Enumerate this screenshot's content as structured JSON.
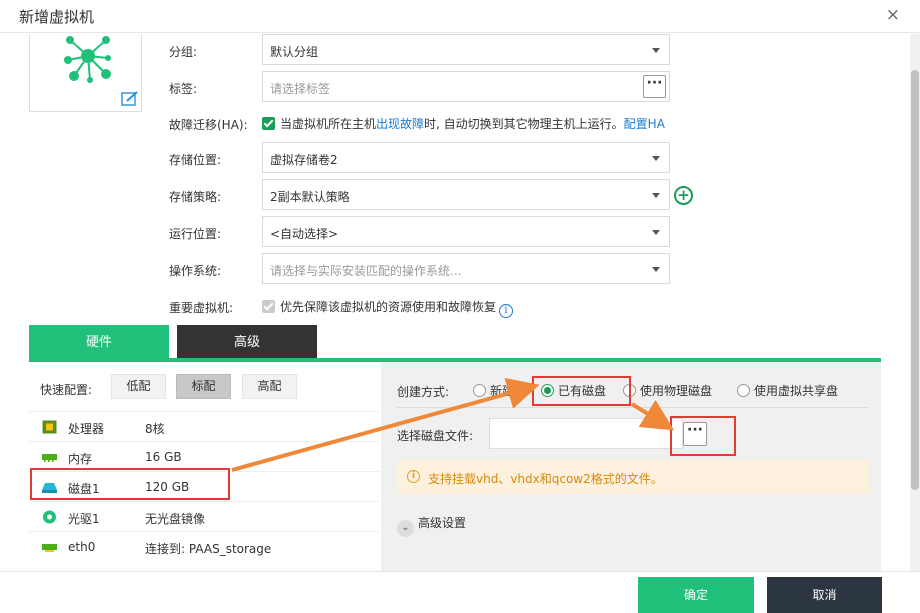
{
  "dialog": {
    "title": "新增虚拟机",
    "close_glyph": "×"
  },
  "form": {
    "group": {
      "label": "分组:",
      "value": "默认分组"
    },
    "tags": {
      "label": "标签:",
      "placeholder": "请选择标签",
      "button": "···"
    },
    "ha": {
      "label": "故障迁移(HA):",
      "text_before": "当虚拟机所在主机",
      "link_fault": "出现故障",
      "text_after": "时, 自动切换到其它物理主机上运行。",
      "link_config": "配置HA",
      "checked": true
    },
    "storage_location": {
      "label": "存储位置:",
      "value": "虚拟存储卷2"
    },
    "storage_policy": {
      "label": "存储策略:",
      "value": "2副本默认策略",
      "add_glyph": "+"
    },
    "run_location": {
      "label": "运行位置:",
      "value": "<自动选择>"
    },
    "os": {
      "label": "操作系统:",
      "placeholder": "请选择与实际安装匹配的操作系统..."
    },
    "important": {
      "label": "重要虚拟机:",
      "text": "优先保障该虚拟机的资源使用和故障恢复",
      "info_glyph": "i",
      "checked": true
    }
  },
  "tabs": [
    {
      "label": "硬件",
      "active": true
    },
    {
      "label": "高级",
      "active": false
    }
  ],
  "hardware": {
    "quick_label": "快速配置:",
    "quick_buttons": [
      {
        "label": "低配"
      },
      {
        "label": "标配",
        "active": true
      },
      {
        "label": "高配"
      }
    ],
    "items": [
      {
        "name": "处理器",
        "value": "8核",
        "icon": "cpu-icon"
      },
      {
        "name": "内存",
        "value": "16 GB",
        "icon": "memory-icon"
      },
      {
        "name": "磁盘1",
        "value": "120 GB",
        "icon": "disk-icon"
      },
      {
        "name": "光驱1",
        "value": "无光盘镜像",
        "icon": "cdrom-icon"
      },
      {
        "name": "eth0",
        "value": "连接到: PAAS_storage",
        "icon": "nic-icon"
      }
    ]
  },
  "disk_panel": {
    "create_label": "创建方式:",
    "options": [
      {
        "label": "新建磁",
        "selected": false
      },
      {
        "label": "已有磁盘",
        "selected": true
      },
      {
        "label": "使用物理磁盘",
        "selected": false
      },
      {
        "label": "使用虚拟共享盘",
        "selected": false
      }
    ],
    "file_label": "选择磁盘文件:",
    "file_value": "",
    "file_button": "···",
    "notice_icon": "i",
    "notice": "支持挂载vhd、vhdx和qcow2格式的文件。",
    "advanced_glyph": "⌄",
    "advanced": "高级设置"
  },
  "footer": {
    "ok": "确定",
    "cancel": "取消"
  },
  "colors": {
    "accent": "#20c07a",
    "dark": "#2b3640",
    "annotation": "#e53935",
    "arrow": "#f0883a",
    "link": "#1d7ad4"
  }
}
